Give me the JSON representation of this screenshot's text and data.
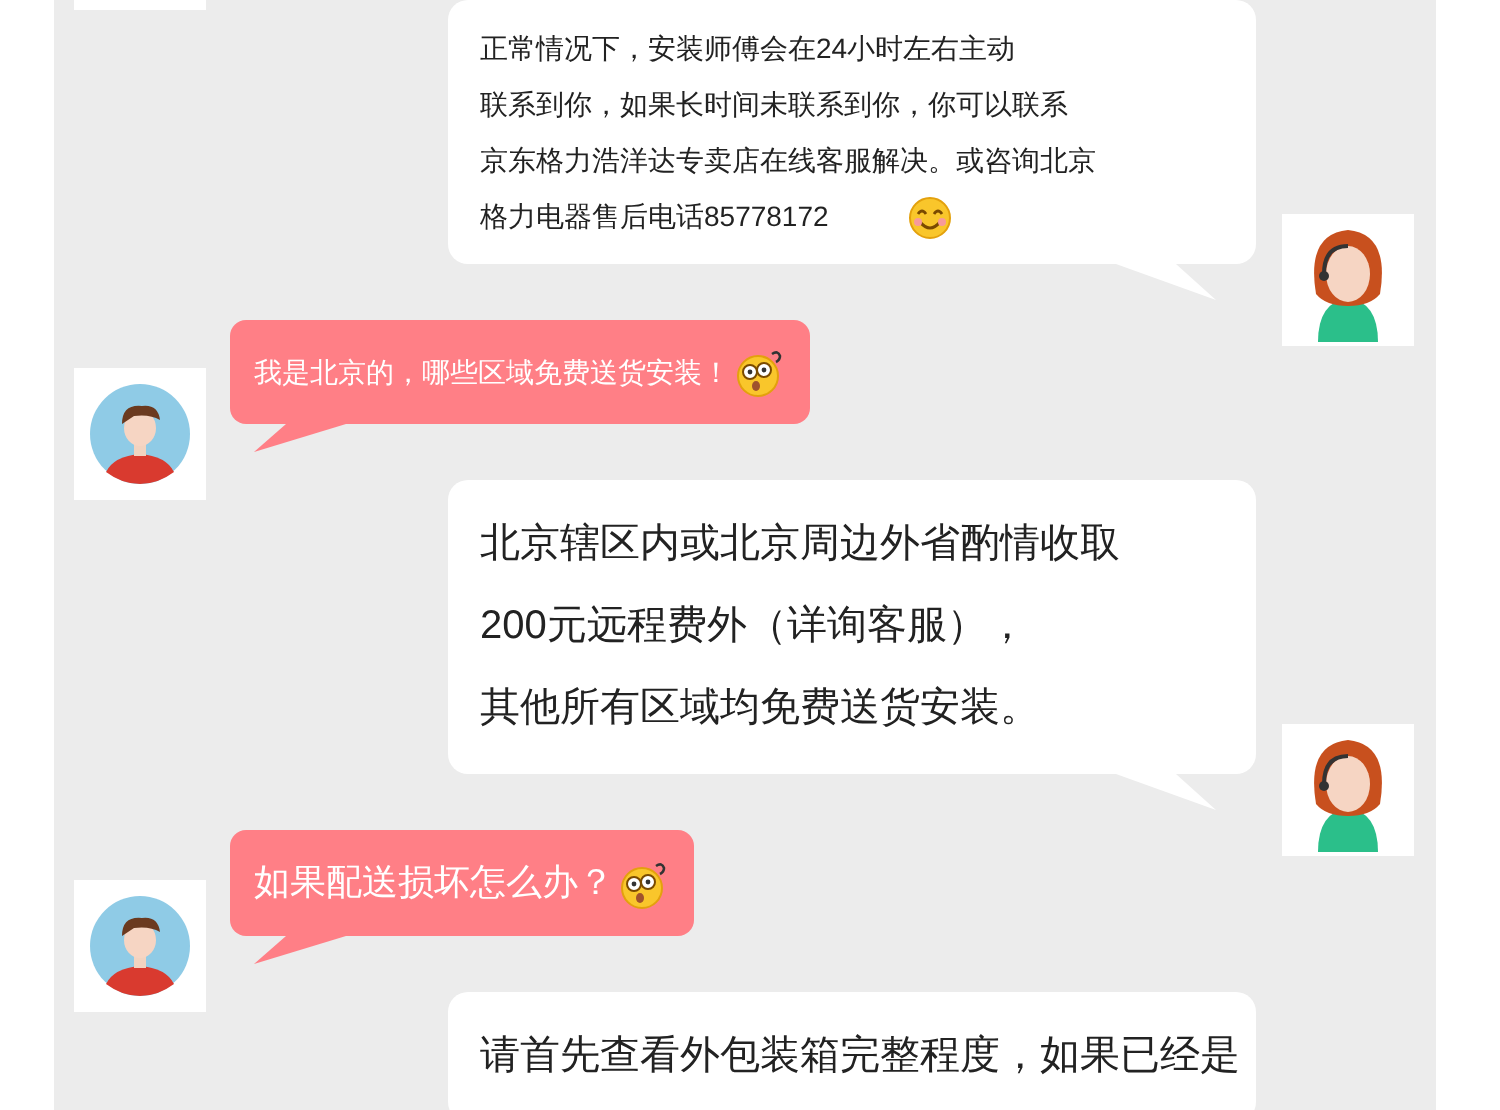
{
  "messages": [
    {
      "kind": "note",
      "has_emoji": true,
      "lines": [
        "正常情况下，安装师傅会在24小时左右主动",
        "联系到你，如果长时间未联系到你，你可以联系",
        "京东格力浩洋达专卖店在线客服解决。或咨询北京",
        "格力电器售后电话85778172"
      ]
    },
    {
      "kind": "ask",
      "has_emoji": true,
      "lines": [
        "我是北京的，哪些区域免费送货安装！"
      ]
    },
    {
      "kind": "answer",
      "has_emoji": false,
      "lines": [
        "北京辖区内或北京周边外省酌情收取",
        "200元远程费外（详询客服），",
        "其他所有区域均免费送货安装。"
      ]
    },
    {
      "kind": "question",
      "has_emoji": true,
      "lines": [
        "如果配送损坏怎么办？"
      ]
    },
    {
      "kind": "answer",
      "has_emoji": false,
      "lines": [
        "请首先查看外包装箱完整程度，如果已经是"
      ]
    }
  ]
}
